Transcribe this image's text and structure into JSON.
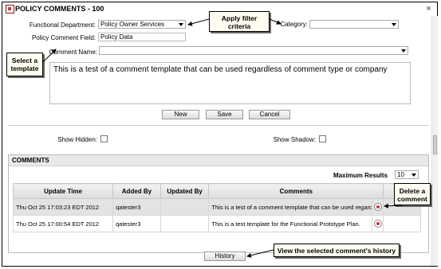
{
  "window": {
    "title": "POLICY COMMENTS - 100",
    "close_glyph": "×"
  },
  "form": {
    "functional_department_label": "Functional Department:",
    "functional_department_value": "Policy Owner Services",
    "category_label": "Category:",
    "category_value": "",
    "policy_comment_field_label": "Policy Comment Field:",
    "policy_comment_field_value": "Policy Data",
    "comment_name_label": "Comment Name:",
    "comment_name_value": "",
    "comment_text": "This is a test of a comment template that can be used regardless of comment type or company"
  },
  "buttons": {
    "new": "New",
    "save": "Save",
    "cancel": "Cancel",
    "history": "History"
  },
  "toggles": {
    "show_hidden_label": "Show Hidden:",
    "show_shadow_label": "Show Shadow:",
    "show_hidden": false,
    "show_shadow": false
  },
  "comments": {
    "heading": "COMMENTS",
    "max_results_label": "Maximum Results",
    "max_results_value": "10",
    "columns": [
      "Update Time",
      "Added By",
      "Updated By",
      "Comments"
    ],
    "rows": [
      {
        "update_time": "Thu Oct 25 17:03:23 EDT 2012",
        "added_by": "qatester3",
        "updated_by": "",
        "comment": "This is a test of a comment template that can be used regardless of comment type or company",
        "selected": true
      },
      {
        "update_time": "Thu Oct 25 17:00:54 EDT 2012",
        "added_by": "qatester3",
        "updated_by": "",
        "comment": "This is a test template for the Functional Prototype Plan.",
        "selected": false
      }
    ]
  },
  "callouts": {
    "apply_filter": "Apply filter criteria",
    "select_template": "Select a template",
    "delete_comment": "Delete a comment",
    "view_history": "View the selected comment's history"
  },
  "icons": {
    "window_icon": "document-icon",
    "delete_icon": "delete-icon",
    "dropdown": "chevron-down-icon"
  }
}
